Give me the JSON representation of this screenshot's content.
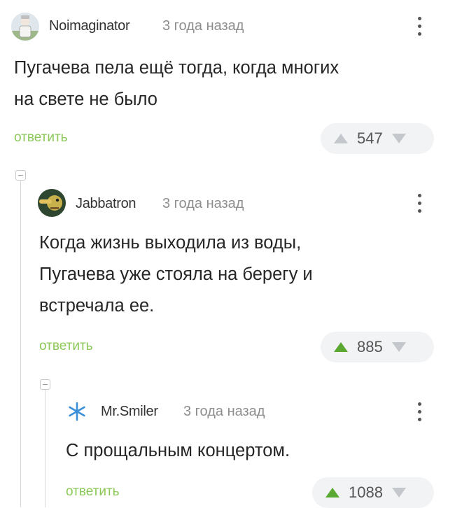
{
  "comments": [
    {
      "username": "Noimaginator",
      "time": "3 года назад",
      "text_lines": [
        "Пугачева пела ещё тогда, когда многих",
        "на свете не было"
      ],
      "reply_label": "ответить",
      "rating": "547"
    },
    {
      "username": "Jabbatron",
      "time": "3 года назад",
      "text_lines": [
        "Когда жизнь выходила из воды,",
        "Пугачева уже стояла на берегу и",
        "встречала ее."
      ],
      "reply_label": "ответить",
      "rating": "885"
    },
    {
      "username": "Mr.Smiler",
      "time": "3 года назад",
      "text_lines": [
        "С прощальным концертом."
      ],
      "reply_label": "ответить",
      "rating": "1088"
    }
  ],
  "colors": {
    "reply_link": "#8ac858",
    "upvote_inactive": "#c4c8cc",
    "upvote_active": "#5aa832",
    "downvote": "#c4c8cc"
  },
  "icons": {
    "menu": "more-vertical-icon",
    "upvote": "triangle-up-icon",
    "downvote": "triangle-down-icon",
    "collapse": "minus-square-icon"
  }
}
